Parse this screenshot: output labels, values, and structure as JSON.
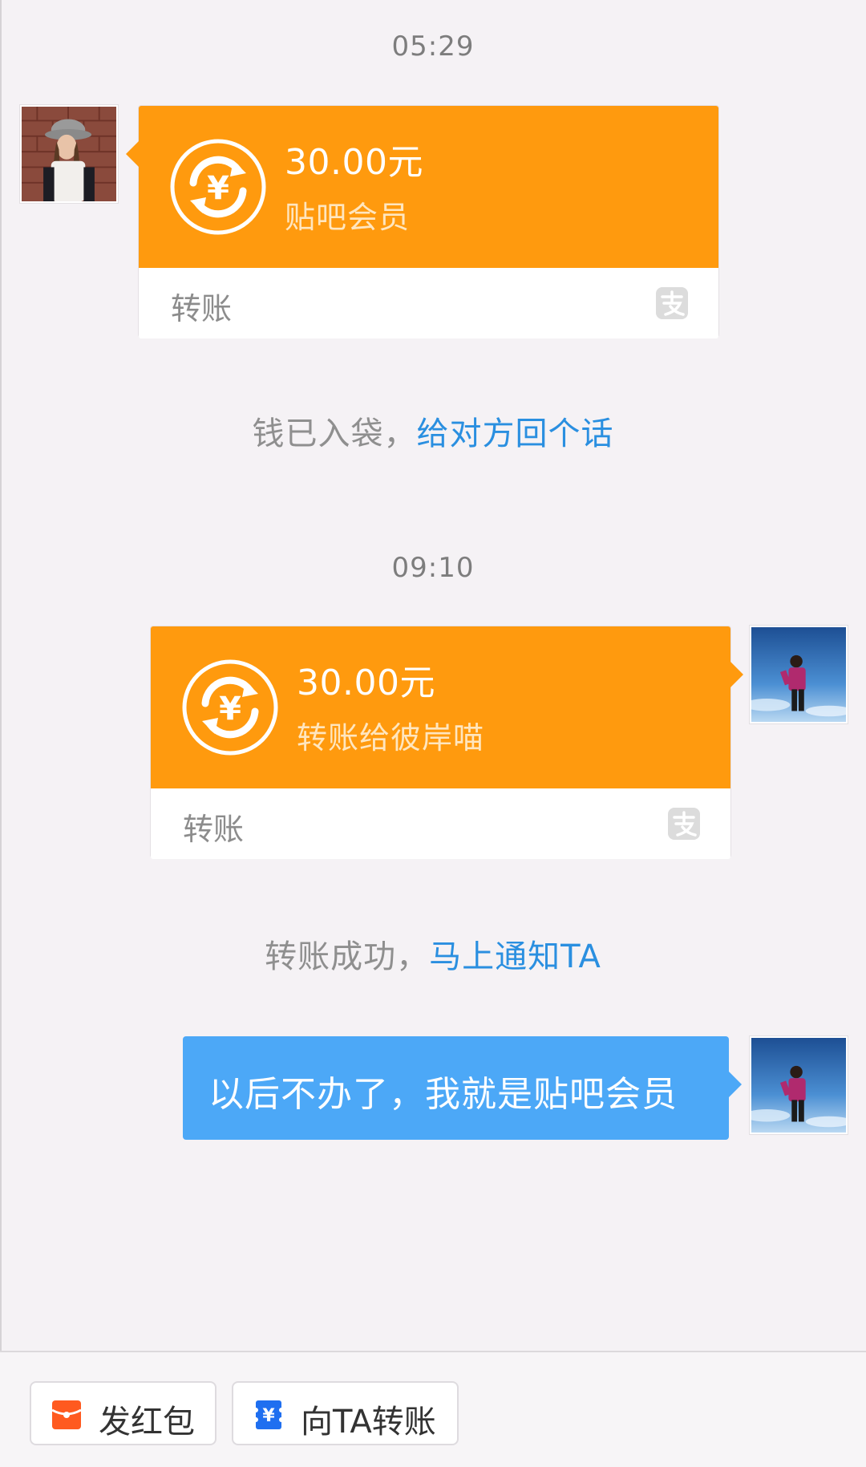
{
  "conversation": {
    "timestamps": [
      "05:29",
      "09:10"
    ],
    "messages": {
      "received_transfer": {
        "amount": "30.00元",
        "note": "贴吧会员",
        "type_label": "转账"
      },
      "received_notice": {
        "text": "钱已入袋，",
        "link": "给对方回个话"
      },
      "sent_transfer": {
        "amount": "30.00元",
        "note": "转账给彼岸喵",
        "type_label": "转账"
      },
      "sent_notice": {
        "text": "转账成功，",
        "link": "马上通知TA"
      },
      "sent_text": "以后不办了，我就是贴吧会员"
    }
  },
  "actions": {
    "red_packet_label": "发红包",
    "transfer_label": "向TA转账"
  },
  "colors": {
    "transfer_orange": "#ff9a0e",
    "text_bubble_blue": "#4ca8f7",
    "link_blue": "#2a8fe0",
    "red_packet_orange": "#ff5a1f",
    "transfer_button_blue": "#1f6ff0"
  },
  "icons": {
    "transfer": "yen-exchange-icon",
    "payment_service": "alipay-icon",
    "red_packet": "red-packet-icon",
    "transfer_button": "yen-transfer-icon"
  }
}
